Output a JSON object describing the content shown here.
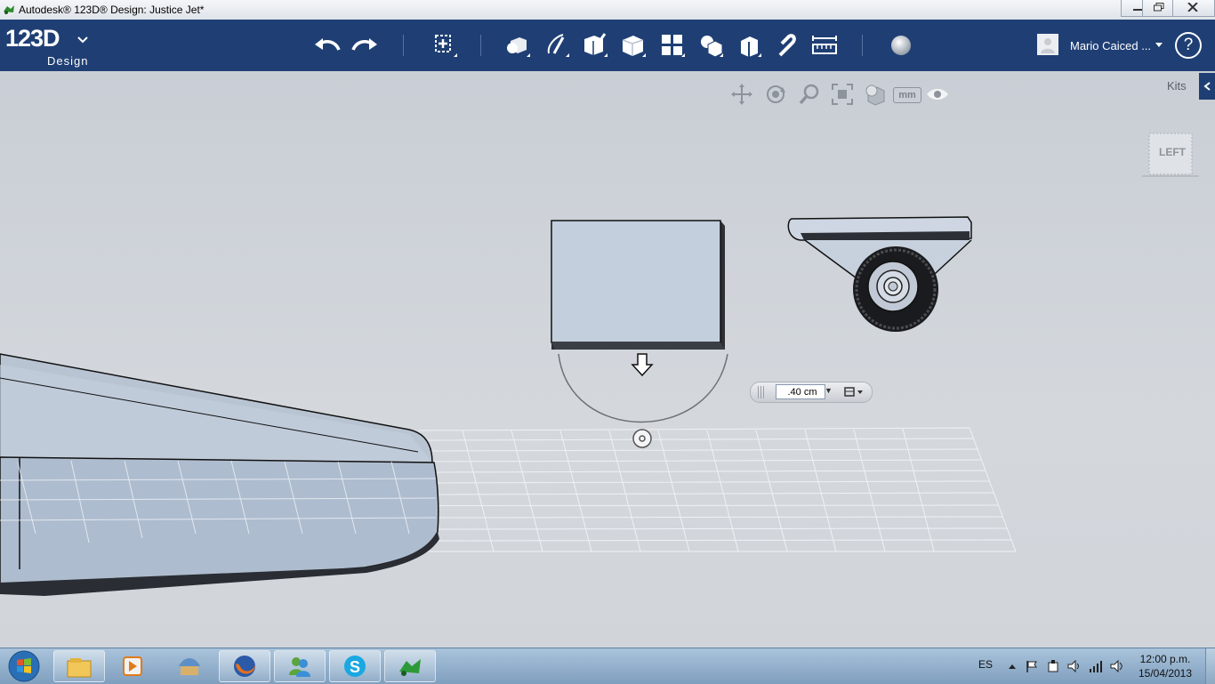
{
  "window": {
    "title": "Autodesk® 123D® Design: Justice Jet*",
    "controls": [
      "minimize-icon",
      "restore-icon",
      "close-icon"
    ]
  },
  "toolbar": {
    "logo_main": "123D",
    "logo_sub": "Design",
    "tools": [
      "undo-icon",
      "redo-icon",
      "transform-icon",
      "primitives-icon",
      "sketch-icon",
      "construct-icon",
      "modify-icon",
      "pattern-icon",
      "grouping-icon",
      "combine-icon",
      "snap-icon",
      "measure-icon",
      "material-icon"
    ],
    "user_name": "Mario Caiced ...",
    "help_label": "?"
  },
  "viewport": {
    "nav_tools": [
      "pan-icon",
      "orbit-icon",
      "zoom-icon",
      "fit-icon",
      "view-mode-icon",
      "units-mm-icon",
      "visibility-eye-icon"
    ],
    "units_label": "mm",
    "kits_label": "Kits",
    "viewcube_label": "LEFT",
    "dimension_value": ".40 cm"
  },
  "taskbar": {
    "apps": [
      "windows-explorer-icon",
      "media-player-icon",
      "app-icon",
      "firefox-icon",
      "messenger-icon",
      "skype-icon",
      "123d-design-icon"
    ],
    "language": "ES",
    "time": "12:00 p.m.",
    "date": "15/04/2013"
  },
  "colors": {
    "toolbar_bg": "#1f3f74",
    "viewport_bg": "#d2d7de",
    "model_blue": "#b8c6d8"
  }
}
